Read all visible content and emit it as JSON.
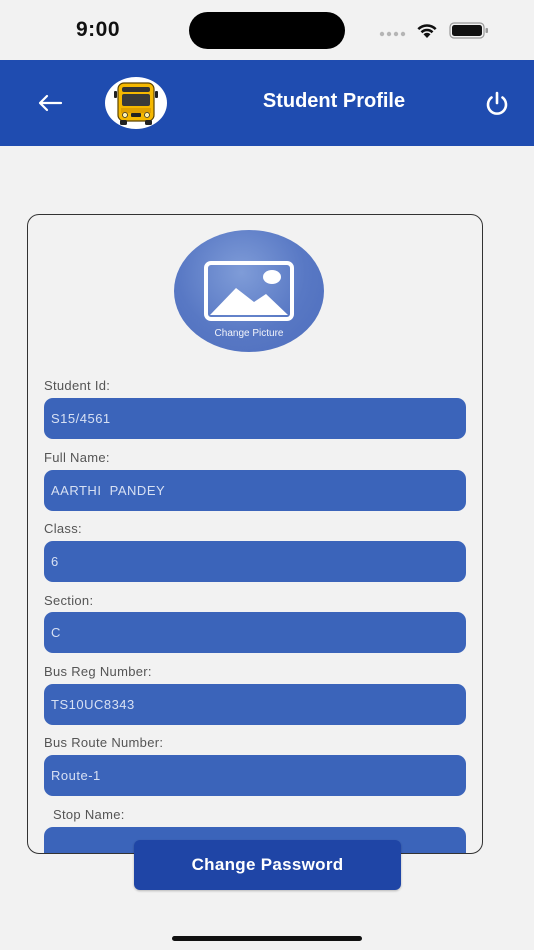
{
  "status_bar": {
    "time": "9:00"
  },
  "header": {
    "title": "Student Profile"
  },
  "profile": {
    "change_picture_label": "Change Picture",
    "fields": [
      {
        "label": "Student Id:",
        "value": "S15/4561"
      },
      {
        "label": "Full Name:",
        "value": "AARTHI  PANDEY"
      },
      {
        "label": "Class:",
        "value": "6"
      },
      {
        "label": "Section:",
        "value": "C"
      },
      {
        "label": "Bus Reg Number:",
        "value": "TS10UC8343"
      },
      {
        "label": "Bus Route Number:",
        "value": "Route-1"
      },
      {
        "label": "Stop Name:",
        "value": ""
      }
    ]
  },
  "actions": {
    "change_password_label": "Change Password"
  },
  "colors": {
    "app_bar": "#1f4cb0",
    "field_bg": "#3b64ba",
    "button_bg": "#1f45a6",
    "background": "#f2f2f2"
  }
}
